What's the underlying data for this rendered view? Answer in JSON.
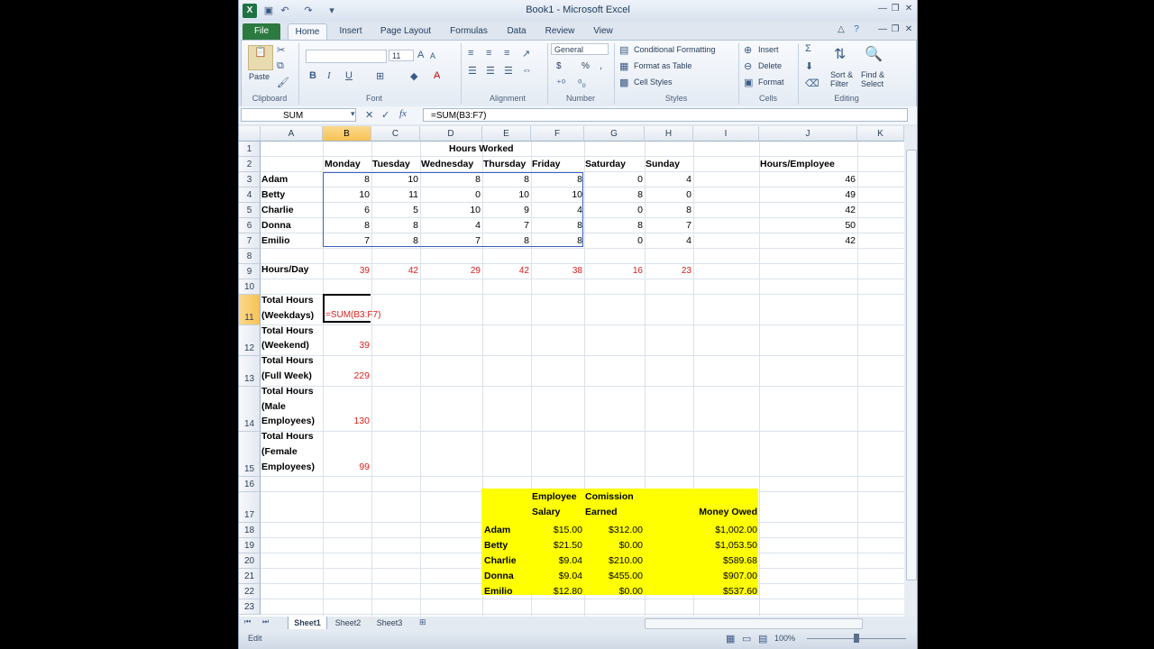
{
  "window": {
    "title": "Book1 - Microsoft Excel"
  },
  "tabs": [
    "File",
    "Home",
    "Insert",
    "Page Layout",
    "Formulas",
    "Data",
    "Review",
    "View"
  ],
  "ribbon": {
    "clipboard": {
      "label": "Clipboard",
      "paste": "Paste"
    },
    "font": {
      "label": "Font",
      "size": "11"
    },
    "alignment": {
      "label": "Alignment"
    },
    "number": {
      "label": "Number",
      "format": "General",
      "currency": "$",
      "percent": "%"
    },
    "styles": {
      "label": "Styles",
      "conditional": "Conditional Formatting",
      "table": "Format as Table",
      "cell": "Cell Styles"
    },
    "cells": {
      "label": "Cells",
      "insert": "Insert",
      "delete": "Delete",
      "format": "Format"
    },
    "editing": {
      "label": "Editing",
      "sort": "Sort &",
      "filter": "Filter",
      "find": "Find &",
      "select": "Select"
    }
  },
  "formula_bar": {
    "name_box": "SUM",
    "formula": "=SUM(B3:F7)"
  },
  "columns": [
    "A",
    "B",
    "C",
    "D",
    "E",
    "F",
    "G",
    "H",
    "I",
    "J",
    "K"
  ],
  "rows": [
    "1",
    "2",
    "3",
    "4",
    "5",
    "6",
    "7",
    "8",
    "9",
    "10",
    "11",
    "12",
    "13",
    "14",
    "15",
    "16",
    "17",
    "18",
    "19",
    "20",
    "21",
    "22",
    "23"
  ],
  "sheet": {
    "title": "Hours Worked",
    "days": [
      "Monday",
      "Tuesday",
      "Wednesday",
      "Thursday",
      "Friday",
      "Saturday",
      "Sunday"
    ],
    "hours_per_employee_label": "Hours/Employee",
    "employees": [
      {
        "name": "Adam",
        "hours": [
          "8",
          "10",
          "8",
          "8",
          "8",
          "0",
          "4"
        ],
        "total": "46"
      },
      {
        "name": "Betty",
        "hours": [
          "10",
          "11",
          "0",
          "10",
          "10",
          "8",
          "0"
        ],
        "total": "49"
      },
      {
        "name": "Charlie",
        "hours": [
          "6",
          "5",
          "10",
          "9",
          "4",
          "0",
          "8"
        ],
        "total": "42"
      },
      {
        "name": "Donna",
        "hours": [
          "8",
          "8",
          "4",
          "7",
          "8",
          "8",
          "7"
        ],
        "total": "50"
      },
      {
        "name": "Emilio",
        "hours": [
          "7",
          "8",
          "7",
          "8",
          "8",
          "0",
          "4"
        ],
        "total": "42"
      }
    ],
    "hours_day_label": "Hours/Day",
    "hours_day": [
      "39",
      "42",
      "29",
      "42",
      "38",
      "16",
      "23"
    ],
    "totals": {
      "weekdays": {
        "l1": "Total Hours",
        "l2": "(Weekdays)",
        "value": "=SUM(B3:F7)"
      },
      "weekend": {
        "l1": "Total Hours",
        "l2": "(Weekend)",
        "value": "39"
      },
      "fullweek": {
        "l1": "Total Hours",
        "l2": "(Full Week)",
        "value": "229"
      },
      "male": {
        "l1": "Total Hours",
        "l2": "(Male",
        "l3": "Employees)",
        "value": "130"
      },
      "female": {
        "l1": "Total Hours",
        "l2": "(Female",
        "l3": "Employees)",
        "value": "99"
      }
    },
    "pay": {
      "header": {
        "employee": "Employee",
        "salary": "Salary",
        "comission": "Comission",
        "earned": "Earned",
        "owed": "Money Owed"
      },
      "rows": [
        {
          "name": "Adam",
          "salary": "$15.00",
          "earned": "$312.00",
          "owed": "$1,002.00"
        },
        {
          "name": "Betty",
          "salary": "$21.50",
          "earned": "$0.00",
          "owed": "$1,053.50"
        },
        {
          "name": "Charlie",
          "salary": "$9.04",
          "earned": "$210.00",
          "owed": "$589.68"
        },
        {
          "name": "Donna",
          "salary": "$9.04",
          "earned": "$455.00",
          "owed": "$907.00"
        },
        {
          "name": "Emilio",
          "salary": "$12.80",
          "earned": "$0.00",
          "owed": "$537.60"
        }
      ]
    }
  },
  "sheet_tabs": [
    "Sheet1",
    "Sheet2",
    "Sheet3"
  ],
  "status": {
    "mode": "Edit",
    "zoom": "100%"
  },
  "colors": {
    "accent": "#2c7a3f",
    "highlight": "#ffff00",
    "selection": "#f7c254",
    "formula_red": "#d82020"
  }
}
